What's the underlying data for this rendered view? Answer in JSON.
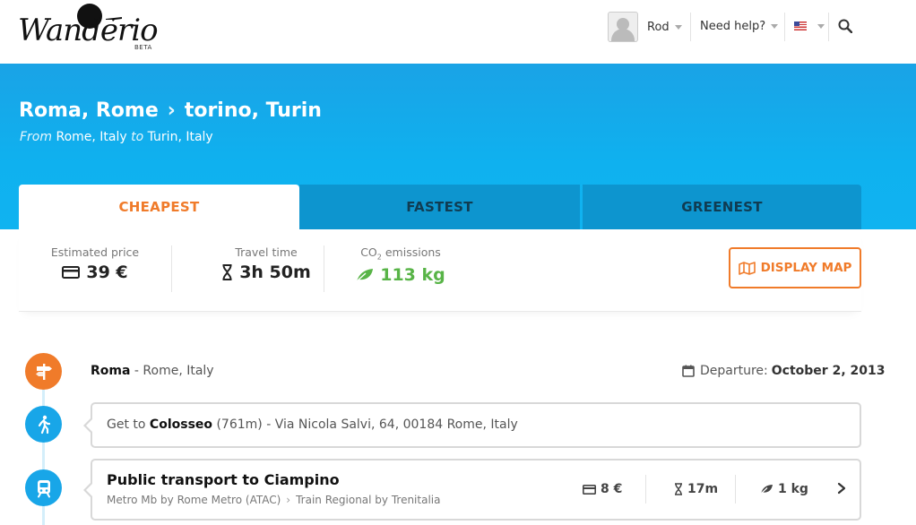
{
  "header": {
    "logo_text": "Wanderio",
    "logo_badge": "BETA",
    "user_name": "Rod",
    "help_label": "Need help?"
  },
  "route": {
    "origin": "Roma, Rome",
    "destination": "torino, Turin",
    "from_word": "From",
    "from_place": "Rome, Italy",
    "to_word": "to",
    "to_place": "Turin, Italy"
  },
  "tabs": [
    {
      "label": "CHEAPEST",
      "active": true
    },
    {
      "label": "FASTEST",
      "active": false
    },
    {
      "label": "GREENEST",
      "active": false
    }
  ],
  "summary": {
    "price_label": "Estimated price",
    "price_value": "39 €",
    "time_label": "Travel time",
    "time_value": "3h 50m",
    "co2_label_prefix": "CO",
    "co2_label_sub": "2",
    "co2_label_suffix": "emissions",
    "co2_value": "113 kg",
    "map_button": "DISPLAY MAP"
  },
  "itinerary": {
    "origin_name": "Roma",
    "origin_sep": "-",
    "origin_place": "Rome, Italy",
    "departure_label": "Departure:",
    "departure_date": "October 2, 2013",
    "walk": {
      "prefix": "Get to",
      "place": "Colosseo",
      "distance": "(761m)",
      "address": "- Via Nicola Salvi, 64, 00184 Rome, Italy"
    },
    "transit": {
      "title": "Public transport to Ciampino",
      "leg1": "Metro Mb by Rome Metro (ATAC)",
      "leg2": "Train Regional by Trenitalia",
      "price": "8 €",
      "duration": "17m",
      "co2": "1 kg"
    }
  },
  "colors": {
    "accent_orange": "#f07b2a",
    "hero_blue": "#10b3f0",
    "inactive_tab": "#0d95cf",
    "green": "#58b447"
  },
  "icons": [
    "search-icon",
    "card-icon",
    "hourglass-icon",
    "leaf-icon",
    "map-icon",
    "calendar-icon",
    "signpost-icon",
    "walk-icon",
    "train-icon",
    "chevron-right-icon"
  ]
}
